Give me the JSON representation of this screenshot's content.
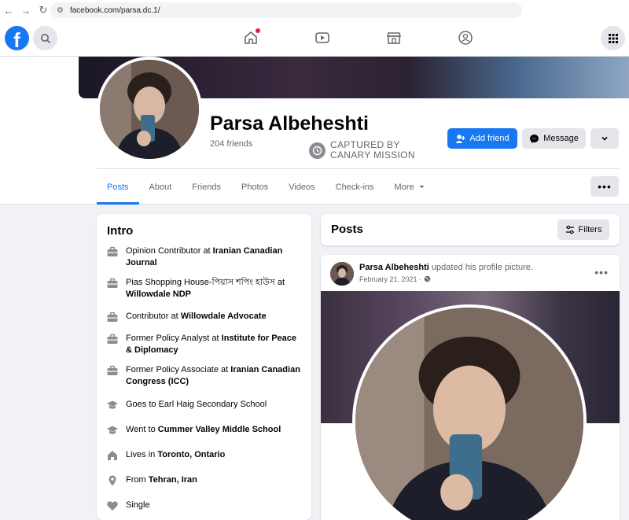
{
  "browser": {
    "url": "facebook.com/parsa.dc.1/"
  },
  "fb_nav": {
    "logo": "f",
    "icons": [
      "search-icon",
      "home-icon",
      "watch-icon",
      "marketplace-icon",
      "groups-icon",
      "menu-grid-icon"
    ]
  },
  "profile": {
    "name": "Parsa Albeheshti",
    "friends": "204 friends",
    "stamp_line1": "CAPTURED BY",
    "stamp_line2": "CANARY MISSION",
    "add_friend": "Add friend",
    "message": "Message"
  },
  "tabs": [
    {
      "label": "Posts",
      "active": true
    },
    {
      "label": "About"
    },
    {
      "label": "Friends"
    },
    {
      "label": "Photos"
    },
    {
      "label": "Videos"
    },
    {
      "label": "Check-ins"
    },
    {
      "label": "More"
    }
  ],
  "intro": {
    "title": "Intro",
    "items": [
      {
        "pre": "Opinion Contributor at ",
        "bold": "Iranian Canadian Journal",
        "icon": "briefcase-icon"
      },
      {
        "pre": "Pias Shopping House-পিয়াস শপিং হাউস at ",
        "bold": "Willowdale NDP",
        "icon": "briefcase-icon"
      },
      {
        "pre": "Contributor at ",
        "bold": "Willowdale Advocate",
        "icon": "briefcase-icon"
      },
      {
        "pre": "Former Policy Analyst at ",
        "bold": "Institute for Peace & Diplomacy",
        "icon": "briefcase-icon"
      },
      {
        "pre": "Former Policy Associate at ",
        "bold": "Iranian Canadian Congress (ICC)",
        "icon": "briefcase-icon"
      },
      {
        "pre": "Goes to Earl Haig Secondary School",
        "bold": "",
        "icon": "graduation-cap-icon"
      },
      {
        "pre": "Went to ",
        "bold": "Cummer Valley Middle School",
        "icon": "graduation-cap-icon"
      },
      {
        "pre": "Lives in ",
        "bold": "Toronto, Ontario",
        "icon": "house-icon"
      },
      {
        "pre": "From ",
        "bold": "Tehran, Iran",
        "icon": "location-pin-icon"
      },
      {
        "pre": "Single",
        "bold": "",
        "icon": "heart-icon"
      }
    ]
  },
  "posts": {
    "title": "Posts",
    "filters": "Filters",
    "post": {
      "author": "Parsa Albeheshti",
      "action": " updated his profile picture.",
      "date": "February 21, 2021 · "
    }
  }
}
